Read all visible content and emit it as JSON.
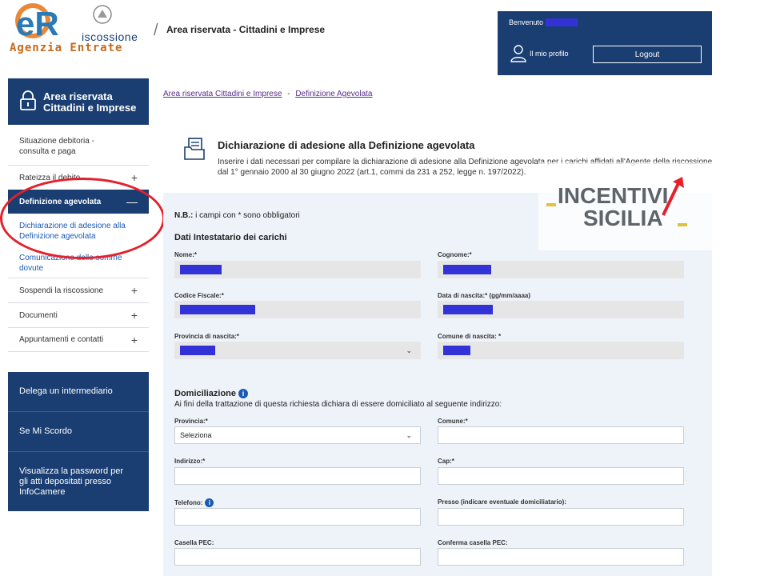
{
  "header": {
    "logo_letters": "eR",
    "logo_brand": "iscossione",
    "logo_sub": "Agenzia Entrate",
    "title": "Area riservata - Cittadini e Imprese"
  },
  "user": {
    "welcome": "Benvenuto",
    "profile_label": "Il mio profilo",
    "logout_label": "Logout"
  },
  "sidebar": {
    "area_title": "Area riservata Cittadini e Imprese",
    "items": [
      {
        "label": "Situazione debitoria - consulta e paga",
        "expandable": false
      },
      {
        "label": "Rateizza il debito",
        "expandable": true,
        "icon": "plus"
      },
      {
        "label": "Definizione agevolata",
        "expandable": true,
        "icon": "minus",
        "active": true
      },
      {
        "label": "Sospendi la riscossione",
        "expandable": true,
        "icon": "plus"
      },
      {
        "label": "Documenti",
        "expandable": true,
        "icon": "plus"
      },
      {
        "label": "Appuntamenti e contatti",
        "expandable": true,
        "icon": "plus"
      }
    ],
    "subitems": [
      "Dichiarazione di adesione alla Definizione agevolata",
      "Comunicazione delle somme dovute"
    ],
    "blue_links": [
      "Delega un intermediario",
      "Se Mi Scordo",
      "Visualizza la password per gli atti depositati presso InfoCamere"
    ]
  },
  "breadcrumb": {
    "home": "Area riservata Cittadini e Imprese",
    "separator": "-",
    "current": "Definizione Agevolata"
  },
  "page": {
    "title": "Dichiarazione di adesione alla Definizione agevolata",
    "description": "Inserire i dati necessari per compilare la dichiarazione di adesione alla Definizione agevolata per i carichi affidati all'Agente della riscossione dal 1° gennaio 2000 al 30 giugno 2022 (art.1, commi da 231 a 252, legge n. 197/2022)."
  },
  "form": {
    "nb_bold": "N.B.:",
    "nb_text": "i campi con * sono obbligatori",
    "section1_title": "Dati Intestatario dei carichi",
    "fields1": {
      "nome": "Nome:*",
      "cognome": "Cognome:*",
      "codice_fiscale": "Codice Fiscale:*",
      "data_nascita": "Data di nascita:* (gg/mm/aaaa)",
      "provincia_nascita": "Provincia di nascita:*",
      "comune_nascita": "Comune di nascita: *"
    },
    "section2_title": "Domiciliazione",
    "section2_desc": "Ai fini della trattazione di questa richiesta dichiara di essere domiciliato al seguente indirizzo:",
    "fields2": {
      "provincia": "Provincia:*",
      "provincia_value": "Seleziona",
      "comune": "Comune:*",
      "indirizzo": "Indirizzo:*",
      "cap": "Cap:*",
      "telefono": "Telefono:",
      "presso": "Presso (indicare eventuale domiciliatario):",
      "pec": "Casella PEC:",
      "pec_confirm": "Conferma casella PEC:"
    }
  },
  "watermark": {
    "line1": "INCENTIVI",
    "line2": "SICILIA"
  },
  "colors": {
    "primary": "#1a3e72",
    "link": "#1a5ab4",
    "redaction": "#3232d6",
    "annotation": "#e5202a"
  }
}
